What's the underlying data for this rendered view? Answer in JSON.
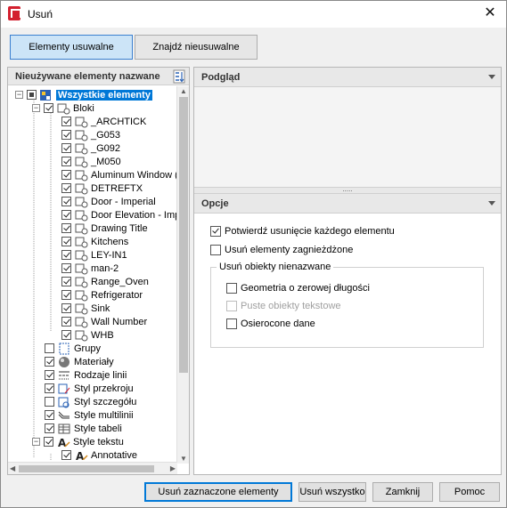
{
  "window": {
    "title": "Usuń",
    "close_glyph": "✕"
  },
  "tabs": [
    {
      "label": "Elementy usuwalne",
      "active": true
    },
    {
      "label": "Znajdź nieusuwalne",
      "active": false
    }
  ],
  "left_panel": {
    "header": "Nieużywane elementy nazwane",
    "sort_icon": "sort-icon"
  },
  "tree": {
    "root": "Wszystkie elementy",
    "blocks_label": "Bloki",
    "blocks": [
      "_ARCHTICK",
      "_G053",
      "_G092",
      "_M050",
      "Aluminum Window (El",
      "DETREFTX",
      "Door - Imperial",
      "Door Elevation - Impe",
      "Drawing Title",
      "Kitchens",
      "LEY-IN1",
      "man-2",
      "Range_Oven",
      "Refrigerator",
      "Sink",
      "Wall Number",
      "WHB"
    ],
    "categories": [
      {
        "label": "Grupy",
        "checked": false,
        "icon": "group-icon"
      },
      {
        "label": "Materiały",
        "checked": true,
        "icon": "material-icon"
      },
      {
        "label": "Rodzaje linii",
        "checked": true,
        "icon": "linetype-icon"
      },
      {
        "label": "Styl przekroju",
        "checked": true,
        "icon": "section-style-icon"
      },
      {
        "label": "Styl szczegółu",
        "checked": false,
        "icon": "detail-style-icon"
      },
      {
        "label": "Style multilinii",
        "checked": true,
        "icon": "multiline-icon"
      },
      {
        "label": "Style tabeli",
        "checked": true,
        "icon": "table-style-icon"
      },
      {
        "label": "Style tekstu",
        "checked": true,
        "icon": "text-style-icon"
      }
    ],
    "text_styles": [
      "Annotative"
    ]
  },
  "preview": {
    "header": "Podgląd"
  },
  "options": {
    "header": "Opcje",
    "confirm_each": {
      "label": "Potwierdź usunięcie każdego elementu",
      "checked": true
    },
    "purge_nested": {
      "label": "Usuń elementy zagnieżdżone",
      "checked": false
    },
    "unnamed_group": {
      "legend": "Usuń obiekty nienazwane",
      "zero_length": {
        "label": "Geometria o zerowej długości",
        "checked": false
      },
      "empty_text": {
        "label": "Puste obiekty tekstowe",
        "checked": false,
        "disabled": true
      },
      "orphaned": {
        "label": "Osierocone dane",
        "checked": false
      }
    }
  },
  "buttons": {
    "purge_checked": "Usuń zaznaczone elementy",
    "purge_all": "Usuń wszystko",
    "close": "Zamknij",
    "help": "Pomoc"
  },
  "colors": {
    "accent": "#0078d7",
    "tab_active_bg": "#cce4f7",
    "app_icon": "#d3202f"
  }
}
